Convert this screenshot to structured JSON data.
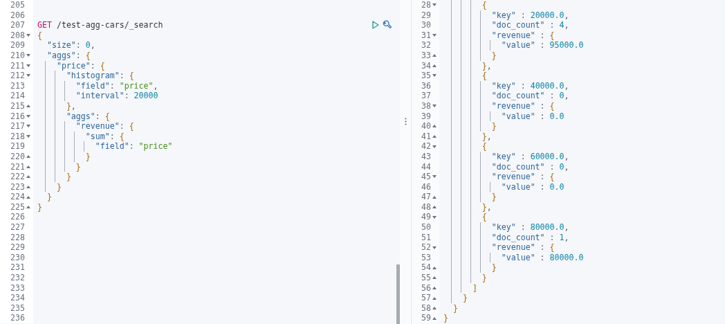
{
  "request_editor": {
    "lines": [
      {
        "num": "205",
        "kind": "blank"
      },
      {
        "num": "206",
        "kind": "blank"
      },
      {
        "num": "207",
        "kind": "request",
        "method": "GET",
        "path": "/test-agg-cars/_search",
        "actions": true
      },
      {
        "num": "208",
        "kind": "open",
        "text": "{"
      },
      {
        "num": "209",
        "kind": "plain",
        "text": "  \"size\": 0,"
      },
      {
        "num": "210",
        "kind": "open",
        "text": "  \"aggs\": {"
      },
      {
        "num": "211",
        "kind": "open",
        "text": "    \"price\": {"
      },
      {
        "num": "212",
        "kind": "open",
        "text": "      \"histogram\": {"
      },
      {
        "num": "213",
        "kind": "plain",
        "text": "        \"field\": \"price\","
      },
      {
        "num": "214",
        "kind": "plain",
        "text": "        \"interval\": 20000"
      },
      {
        "num": "215",
        "kind": "close",
        "text": "      },"
      },
      {
        "num": "216",
        "kind": "open",
        "text": "      \"aggs\": {"
      },
      {
        "num": "217",
        "kind": "open",
        "text": "        \"revenue\": {"
      },
      {
        "num": "218",
        "kind": "open",
        "text": "          \"sum\": {"
      },
      {
        "num": "219",
        "kind": "plain",
        "text": "            \"field\": \"price\""
      },
      {
        "num": "220",
        "kind": "close",
        "text": "          }"
      },
      {
        "num": "221",
        "kind": "close",
        "text": "        }"
      },
      {
        "num": "222",
        "kind": "close",
        "text": "      }"
      },
      {
        "num": "223",
        "kind": "close",
        "text": "    }"
      },
      {
        "num": "224",
        "kind": "close",
        "text": "  }"
      },
      {
        "num": "225",
        "kind": "close",
        "text": "}"
      },
      {
        "num": "226",
        "kind": "blank"
      },
      {
        "num": "227",
        "kind": "blank"
      },
      {
        "num": "228",
        "kind": "blank"
      },
      {
        "num": "229",
        "kind": "blank"
      },
      {
        "num": "230",
        "kind": "blank"
      },
      {
        "num": "231",
        "kind": "blank"
      },
      {
        "num": "232",
        "kind": "blank"
      },
      {
        "num": "233",
        "kind": "blank"
      },
      {
        "num": "234",
        "kind": "blank"
      },
      {
        "num": "235",
        "kind": "blank"
      },
      {
        "num": "236",
        "kind": "blank"
      }
    ]
  },
  "response_viewer": {
    "lines": [
      {
        "num": "28",
        "kind": "open",
        "text": "        {"
      },
      {
        "num": "29",
        "kind": "plain",
        "text": "          \"key\" : 20000.0,"
      },
      {
        "num": "30",
        "kind": "plain",
        "text": "          \"doc_count\" : 4,"
      },
      {
        "num": "31",
        "kind": "open",
        "text": "          \"revenue\" : {"
      },
      {
        "num": "32",
        "kind": "plain",
        "text": "            \"value\" : 95000.0"
      },
      {
        "num": "33",
        "kind": "close",
        "text": "          }"
      },
      {
        "num": "34",
        "kind": "close",
        "text": "        },"
      },
      {
        "num": "35",
        "kind": "open",
        "text": "        {"
      },
      {
        "num": "36",
        "kind": "plain",
        "text": "          \"key\" : 40000.0,"
      },
      {
        "num": "37",
        "kind": "plain",
        "text": "          \"doc_count\" : 0,"
      },
      {
        "num": "38",
        "kind": "open",
        "text": "          \"revenue\" : {"
      },
      {
        "num": "39",
        "kind": "plain",
        "text": "            \"value\" : 0.0"
      },
      {
        "num": "40",
        "kind": "close",
        "text": "          }"
      },
      {
        "num": "41",
        "kind": "close",
        "text": "        },"
      },
      {
        "num": "42",
        "kind": "open",
        "text": "        {"
      },
      {
        "num": "43",
        "kind": "plain",
        "text": "          \"key\" : 60000.0,"
      },
      {
        "num": "44",
        "kind": "plain",
        "text": "          \"doc_count\" : 0,"
      },
      {
        "num": "45",
        "kind": "open",
        "text": "          \"revenue\" : {"
      },
      {
        "num": "46",
        "kind": "plain",
        "text": "            \"value\" : 0.0"
      },
      {
        "num": "47",
        "kind": "close",
        "text": "          }"
      },
      {
        "num": "48",
        "kind": "close",
        "text": "        },"
      },
      {
        "num": "49",
        "kind": "open",
        "text": "        {"
      },
      {
        "num": "50",
        "kind": "plain",
        "text": "          \"key\" : 80000.0,"
      },
      {
        "num": "51",
        "kind": "plain",
        "text": "          \"doc_count\" : 1,"
      },
      {
        "num": "52",
        "kind": "open",
        "text": "          \"revenue\" : {"
      },
      {
        "num": "53",
        "kind": "plain",
        "text": "            \"value\" : 80000.0"
      },
      {
        "num": "54",
        "kind": "close",
        "text": "          }"
      },
      {
        "num": "55",
        "kind": "close",
        "text": "        }"
      },
      {
        "num": "56",
        "kind": "close",
        "text": "      ]"
      },
      {
        "num": "57",
        "kind": "close",
        "text": "    }"
      },
      {
        "num": "58",
        "kind": "close",
        "text": "  }"
      },
      {
        "num": "59",
        "kind": "close",
        "text": "}"
      }
    ]
  }
}
